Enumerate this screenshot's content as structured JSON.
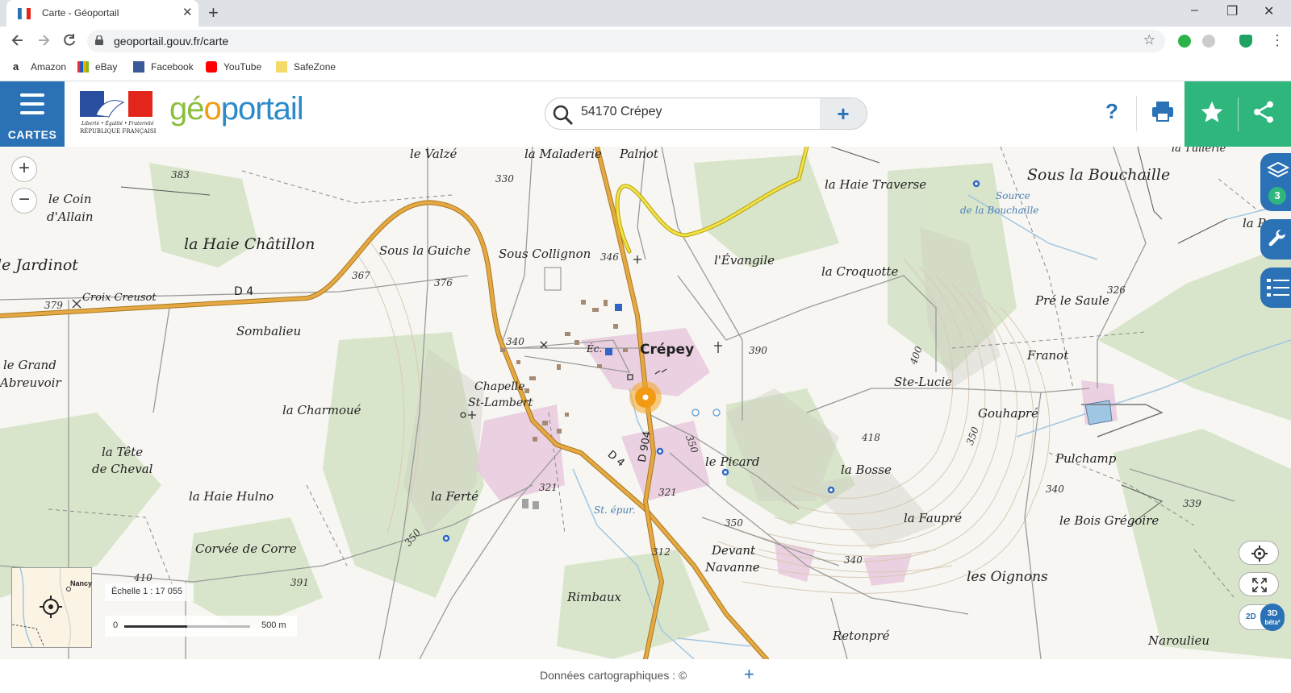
{
  "browser": {
    "tab_title": "Carte - Géoportail",
    "tab_close": "✕",
    "new_tab": "+",
    "url": "geoportail.gouv.fr/carte",
    "window_controls": [
      "–",
      "❐",
      "✕"
    ],
    "nav_icons": [
      "arrow-left-icon",
      "arrow-right-icon",
      "reload-icon"
    ],
    "bookmarks": [
      {
        "label": "Amazon",
        "icon": "amazon-icon",
        "color": "#222222"
      },
      {
        "label": "eBay",
        "icon": "ebay-icon",
        "color": "#e53238"
      },
      {
        "label": "Facebook",
        "icon": "facebook-icon",
        "color": "#3b5998"
      },
      {
        "label": "YouTube",
        "icon": "youtube-icon",
        "color": "#ff0000"
      },
      {
        "label": "SafeZone",
        "icon": "folder-icon",
        "color": "#f4d96b"
      }
    ]
  },
  "header": {
    "menu_label": "CARTES",
    "logo_parts": [
      "g",
      "é",
      "o",
      "portail"
    ],
    "search_value": "54170 Crépey",
    "search_plus": "+",
    "help_label": "?",
    "accent_color": "#2a72b5",
    "green_color": "#2eb67d"
  },
  "map": {
    "zoom_in": "+",
    "zoom_out": "−",
    "layers_count": "3",
    "scale_label": "Échelle 1 : 17 055",
    "scale_start": "0",
    "scale_end": "500 m",
    "minimap_label": "Nancy",
    "mode_2d": "2D",
    "mode_3d": "3D",
    "mode_3d_sub": "bêta²",
    "places": [
      "le Valzé",
      "la Maladerie",
      "Palnot",
      "la Haie Traverse",
      "Sous la Bouchaille",
      "la Tuilerie",
      "le Coin",
      "d'Allain",
      "la Haie Châtillon",
      "Sous la Guiche",
      "Sous Collignon",
      "l'Évangile",
      "la Croquotte",
      "le Jardinot",
      "Croix Creusot",
      "D 4",
      "Sombalieu",
      "Crépey",
      "Ste-Lucie",
      "Pré le Saule",
      "Franot",
      "le Grand",
      "Abreuvoir",
      "Chapelle",
      "St-Lambert",
      "la Charmoué",
      "Gouhapré",
      "la Tête",
      "de Cheval",
      "la Haie Hulno",
      "la Ferté",
      "le Picard",
      "la Bosse",
      "Pulchamp",
      "la Faupré",
      "le Bois Grégoire",
      "Corvée de Corre",
      "Devant",
      "Navanne",
      "les Oignons",
      "Rimbaux",
      "Retonpré",
      "Naroulieu",
      "la P",
      "D 4",
      "D 904",
      "Éc.",
      "St. épur."
    ],
    "spring_label_1": "Source",
    "spring_label_2": "de la Bouchaille",
    "altitudes": [
      "383",
      "330",
      "346",
      "367",
      "376",
      "379",
      "340",
      "390",
      "326",
      "400",
      "418",
      "350",
      "321",
      "321",
      "350",
      "340",
      "339",
      "350",
      "312",
      "340",
      "410",
      "391",
      "350"
    ]
  },
  "footer": {
    "credits": "Données cartographiques : ©",
    "plus": "+"
  }
}
